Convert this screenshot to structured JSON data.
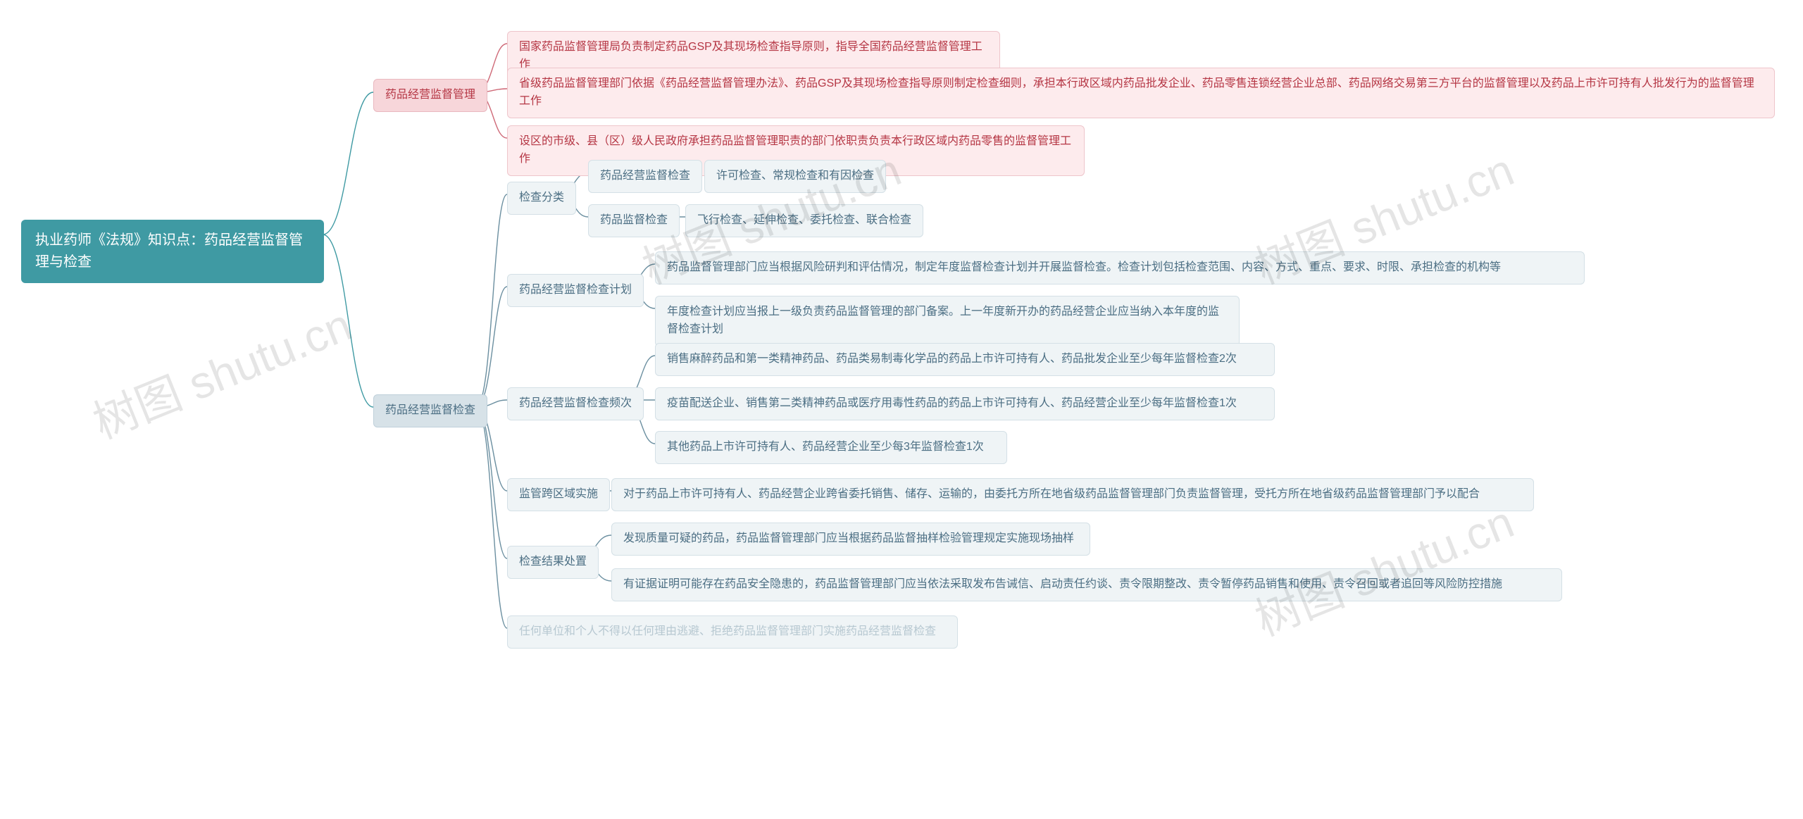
{
  "root": {
    "title": "执业药师《法规》知识点：药品经营监督管理与检查"
  },
  "branch1": {
    "label": "药品经营监督管理",
    "items": [
      "国家药品监督管理局负责制定药品GSP及其现场检查指导原则，指导全国药品经营监督管理工作",
      "省级药品监督管理部门依据《药品经营监督管理办法》、药品GSP及其现场检查指导原则制定检查细则，承担本行政区域内药品批发企业、药品零售连锁经营企业总部、药品网络交易第三方平台的监督管理以及药品上市许可持有人批发行为的监督管理工作",
      "设区的市级、县（区）级人民政府承担药品监督管理职责的部门依职责负责本行政区域内药品零售的监督管理工作"
    ]
  },
  "branch2": {
    "label": "药品经营监督检查",
    "sub1": {
      "label": "检查分类",
      "items": [
        {
          "label": "药品经营监督检查",
          "text": "许可检查、常规检查和有因检查"
        },
        {
          "label": "药品监督检查",
          "text": "飞行检查、延伸检查、委托检查、联合检查"
        }
      ]
    },
    "sub2": {
      "label": "药品经营监督检查计划",
      "items": [
        "药品监督管理部门应当根据风险研判和评估情况，制定年度监督检查计划并开展监督检查。检查计划包括检查范围、内容、方式、重点、要求、时限、承担检查的机构等",
        "年度检查计划应当报上一级负责药品监督管理的部门备案。上一年度新开办的药品经营企业应当纳入本年度的监督检查计划"
      ]
    },
    "sub3": {
      "label": "药品经营监督检查频次",
      "items": [
        "销售麻醉药品和第一类精神药品、药品类易制毒化学品的药品上市许可持有人、药品批发企业至少每年监督检查2次",
        "疫苗配送企业、销售第二类精神药品或医疗用毒性药品的药品上市许可持有人、药品经营企业至少每年监督检查1次",
        "其他药品上市许可持有人、药品经营企业至少每3年监督检查1次"
      ]
    },
    "sub4": {
      "label": "监管跨区域实施",
      "items": [
        "对于药品上市许可持有人、药品经营企业跨省委托销售、储存、运输的，由委托方所在地省级药品监督管理部门负责监督管理，受托方所在地省级药品监督管理部门予以配合"
      ]
    },
    "sub5": {
      "label": "检查结果处置",
      "items": [
        "发现质量可疑的药品，药品监督管理部门应当根据药品监督抽样检验管理规定实施现场抽样",
        "有证据证明可能存在药品安全隐患的，药品监督管理部门应当依法采取发布告诫信、启动责任约谈、责令限期整改、责令暂停药品销售和使用、责令召回或者追回等风险防控措施"
      ]
    },
    "note": "任何单位和个人不得以任何理由逃避、拒绝药品监督管理部门实施药品经营监督检查"
  },
  "watermark": "树图 shutu.cn"
}
